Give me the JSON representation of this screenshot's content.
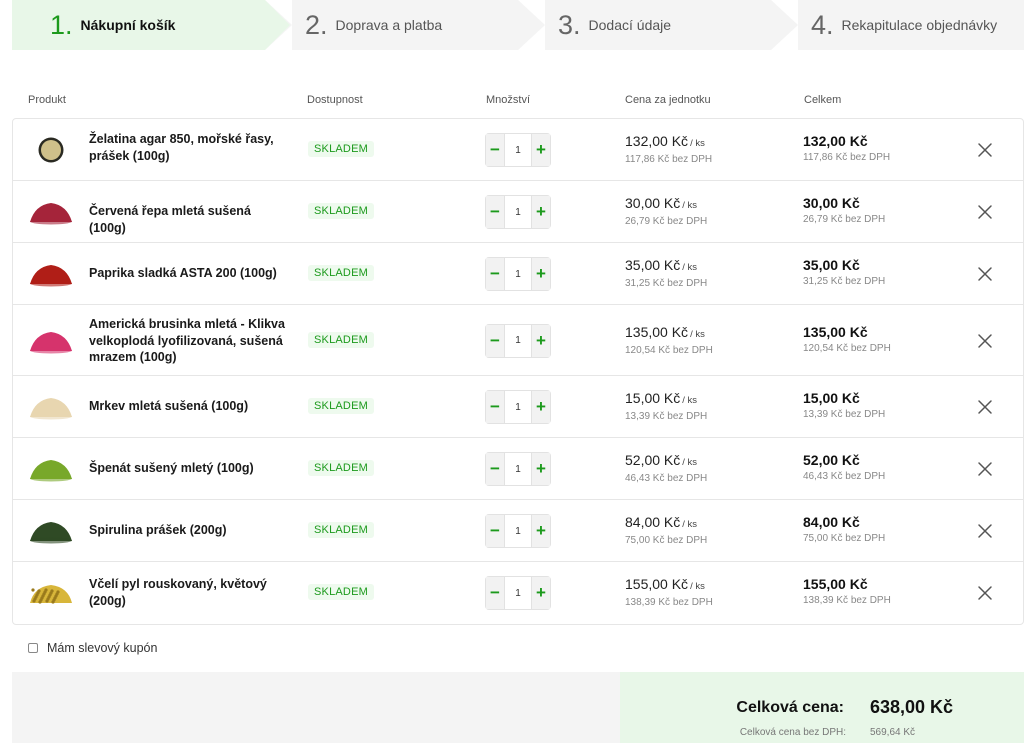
{
  "steps": [
    {
      "num": "1.",
      "label": "Nákupní košík"
    },
    {
      "num": "2.",
      "label": "Doprava a platba"
    },
    {
      "num": "3.",
      "label": "Dodací údaje"
    },
    {
      "num": "4.",
      "label": "Rekapitulace objednávky"
    }
  ],
  "table": {
    "headers": {
      "product": "Produkt",
      "availability": "Dostupnost",
      "quantity": "Množství",
      "unit_price": "Cena za jednotku",
      "total": "Celkem"
    }
  },
  "items": [
    {
      "name": "Želatina agar 850, mořské řasy, prášek (100g)",
      "stock": "SKLADEM",
      "qty": "1",
      "price": "132,00 Kč",
      "unit": "/ ks",
      "price_net": "117,86 Kč bez DPH",
      "total": "132,00 Kč",
      "total_net": "117,86 Kč bez DPH",
      "color": "#cfc08a",
      "thumb": "bowl-icon"
    },
    {
      "name": "Červená řepa mletá sušená (100g)",
      "stock": "SKLADEM",
      "qty": "1",
      "price": "30,00 Kč",
      "unit": "/ ks",
      "price_net": "26,79 Kč bez DPH",
      "total": "30,00 Kč",
      "total_net": "26,79 Kč bez DPH",
      "color": "#a5243a",
      "thumb": "powder-pile-icon"
    },
    {
      "name": "Paprika sladká ASTA 200 (100g)",
      "stock": "SKLADEM",
      "qty": "1",
      "price": "35,00 Kč",
      "unit": "/ ks",
      "price_net": "31,25 Kč bez DPH",
      "total": "35,00 Kč",
      "total_net": "31,25 Kč bez DPH",
      "color": "#b01e17",
      "thumb": "powder-pile-icon"
    },
    {
      "name": "Americká brusinka mletá - Klikva velkoplodá lyofilizovaná, sušená mrazem (100g)",
      "stock": "SKLADEM",
      "qty": "1",
      "price": "135,00 Kč",
      "unit": "/ ks",
      "price_net": "120,54 Kč bez DPH",
      "total": "135,00 Kč",
      "total_net": "120,54 Kč bez DPH",
      "color": "#d6336c",
      "thumb": "powder-pile-icon"
    },
    {
      "name": "Mrkev mletá sušená (100g)",
      "stock": "SKLADEM",
      "qty": "1",
      "price": "15,00 Kč",
      "unit": "/ ks",
      "price_net": "13,39 Kč bez DPH",
      "total": "15,00 Kč",
      "total_net": "13,39 Kč bez DPH",
      "color": "#e8d6b0",
      "thumb": "powder-pile-icon"
    },
    {
      "name": "Špenát sušený mletý (100g)",
      "stock": "SKLADEM",
      "qty": "1",
      "price": "52,00 Kč",
      "unit": "/ ks",
      "price_net": "46,43 Kč bez DPH",
      "total": "52,00 Kč",
      "total_net": "46,43 Kč bez DPH",
      "color": "#78a82a",
      "thumb": "powder-pile-icon"
    },
    {
      "name": "Spirulina prášek (200g)",
      "stock": "SKLADEM",
      "qty": "1",
      "price": "84,00 Kč",
      "unit": "/ ks",
      "price_net": "75,00 Kč bez DPH",
      "total": "84,00 Kč",
      "total_net": "75,00 Kč bez DPH",
      "color": "#2f4a25",
      "thumb": "powder-pile-icon"
    },
    {
      "name": "Včelí pyl rouskovaný, květový (200g)",
      "stock": "SKLADEM",
      "qty": "1",
      "price": "155,00 Kč",
      "unit": "/ ks",
      "price_net": "138,39 Kč bez DPH",
      "total": "155,00 Kč",
      "total_net": "138,39 Kč bez DPH",
      "color": "#d8b63a",
      "thumb": "granules-pile-icon"
    }
  ],
  "coupon": {
    "label": "Mám slevový kupón"
  },
  "summary": {
    "total_label": "Celková cena:",
    "total_value": "638,00 Kč",
    "net_label": "Celková cena bez DPH:",
    "net_value": "569,64 Kč"
  },
  "colors": {
    "accent": "#1c9a1c",
    "accent_bg": "#e8f7e8"
  }
}
